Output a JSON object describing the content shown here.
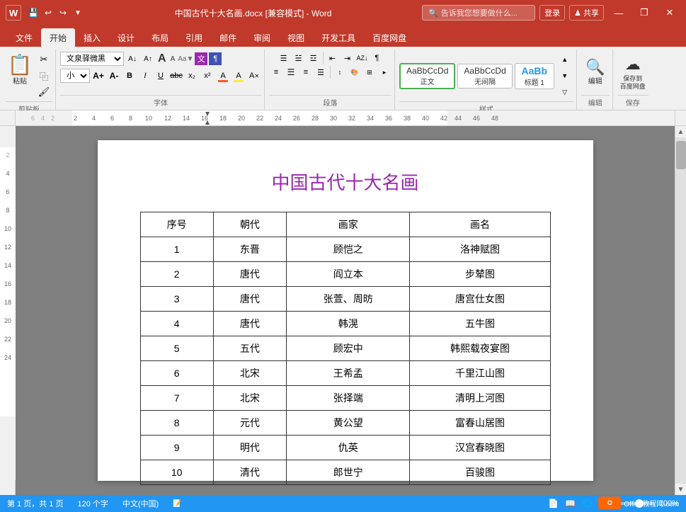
{
  "titlebar": {
    "title": "中国古代十大名画.docx [兼容模式] - Word",
    "app_name": "Word",
    "minimize_label": "—",
    "restore_label": "❐",
    "close_label": "✕"
  },
  "ribbon": {
    "tabs": [
      "文件",
      "开始",
      "插入",
      "设计",
      "布局",
      "引用",
      "邮件",
      "审阅",
      "视图",
      "开发工具",
      "百度网盘"
    ],
    "active_tab": "开始",
    "groups": {
      "clipboard": {
        "label": "剪贴板",
        "paste": "粘贴",
        "cut": "✂",
        "copy": "⿻",
        "format_painter": "🖌"
      },
      "font": {
        "label": "字体",
        "font_name": "文泉驿微黑",
        "font_size": "小初",
        "bold": "B",
        "italic": "I",
        "underline": "U",
        "strikethrough": "abc",
        "subscript": "x₂",
        "superscript": "x²"
      },
      "paragraph": {
        "label": "段落"
      },
      "styles": {
        "label": "样式",
        "items": [
          "AaBbCcDd",
          "AaBbCcDd",
          "AaBb"
        ],
        "names": [
          "正文",
          "无间隔",
          "标题 1"
        ]
      },
      "editing": {
        "label": "编辑",
        "find": "编辑"
      },
      "save": {
        "label": "保存",
        "save_btn": "保存到\n百度网盘"
      }
    }
  },
  "quick_access": {
    "save": "💾",
    "undo": "↩",
    "redo": "↪"
  },
  "ruler": {
    "units": [
      "-4",
      "-2",
      "2",
      "4",
      "6",
      "8",
      "10",
      "12",
      "14",
      "16",
      "18",
      "20",
      "22",
      "24",
      "26",
      "28",
      "30",
      "32",
      "34",
      "36",
      "38",
      "40",
      "42",
      "44",
      "46",
      "48"
    ]
  },
  "document": {
    "title": "中国古代十大名画",
    "table": {
      "headers": [
        "序号",
        "朝代",
        "画家",
        "画名"
      ],
      "rows": [
        [
          "1",
          "东晋",
          "顾恺之",
          "洛神赋图"
        ],
        [
          "2",
          "唐代",
          "阎立本",
          "步辇图"
        ],
        [
          "3",
          "唐代",
          "张萱、周昉",
          "唐宫仕女图"
        ],
        [
          "4",
          "唐代",
          "韩滉",
          "五牛图"
        ],
        [
          "5",
          "五代",
          "顾宏中",
          "韩熙载夜宴图"
        ],
        [
          "6",
          "北宋",
          "王希孟",
          "千里江山图"
        ],
        [
          "7",
          "北宋",
          "张择端",
          "清明上河图"
        ],
        [
          "8",
          "元代",
          "黄公望",
          "富春山居图"
        ],
        [
          "9",
          "明代",
          "仇英",
          "汉宫春晓图"
        ],
        [
          "10",
          "清代",
          "郎世宁",
          "百骏图"
        ]
      ]
    }
  },
  "statusbar": {
    "page_info": "第 1 页，共 1 页",
    "char_count": "120 个字",
    "language": "中文(中国)",
    "zoom": "100%"
  },
  "search_placeholder": "告诉我您想要做什么...",
  "login_btn": "登录",
  "share_btn": "♟ 共享",
  "bottom_right_logo": "Office教程网.com"
}
